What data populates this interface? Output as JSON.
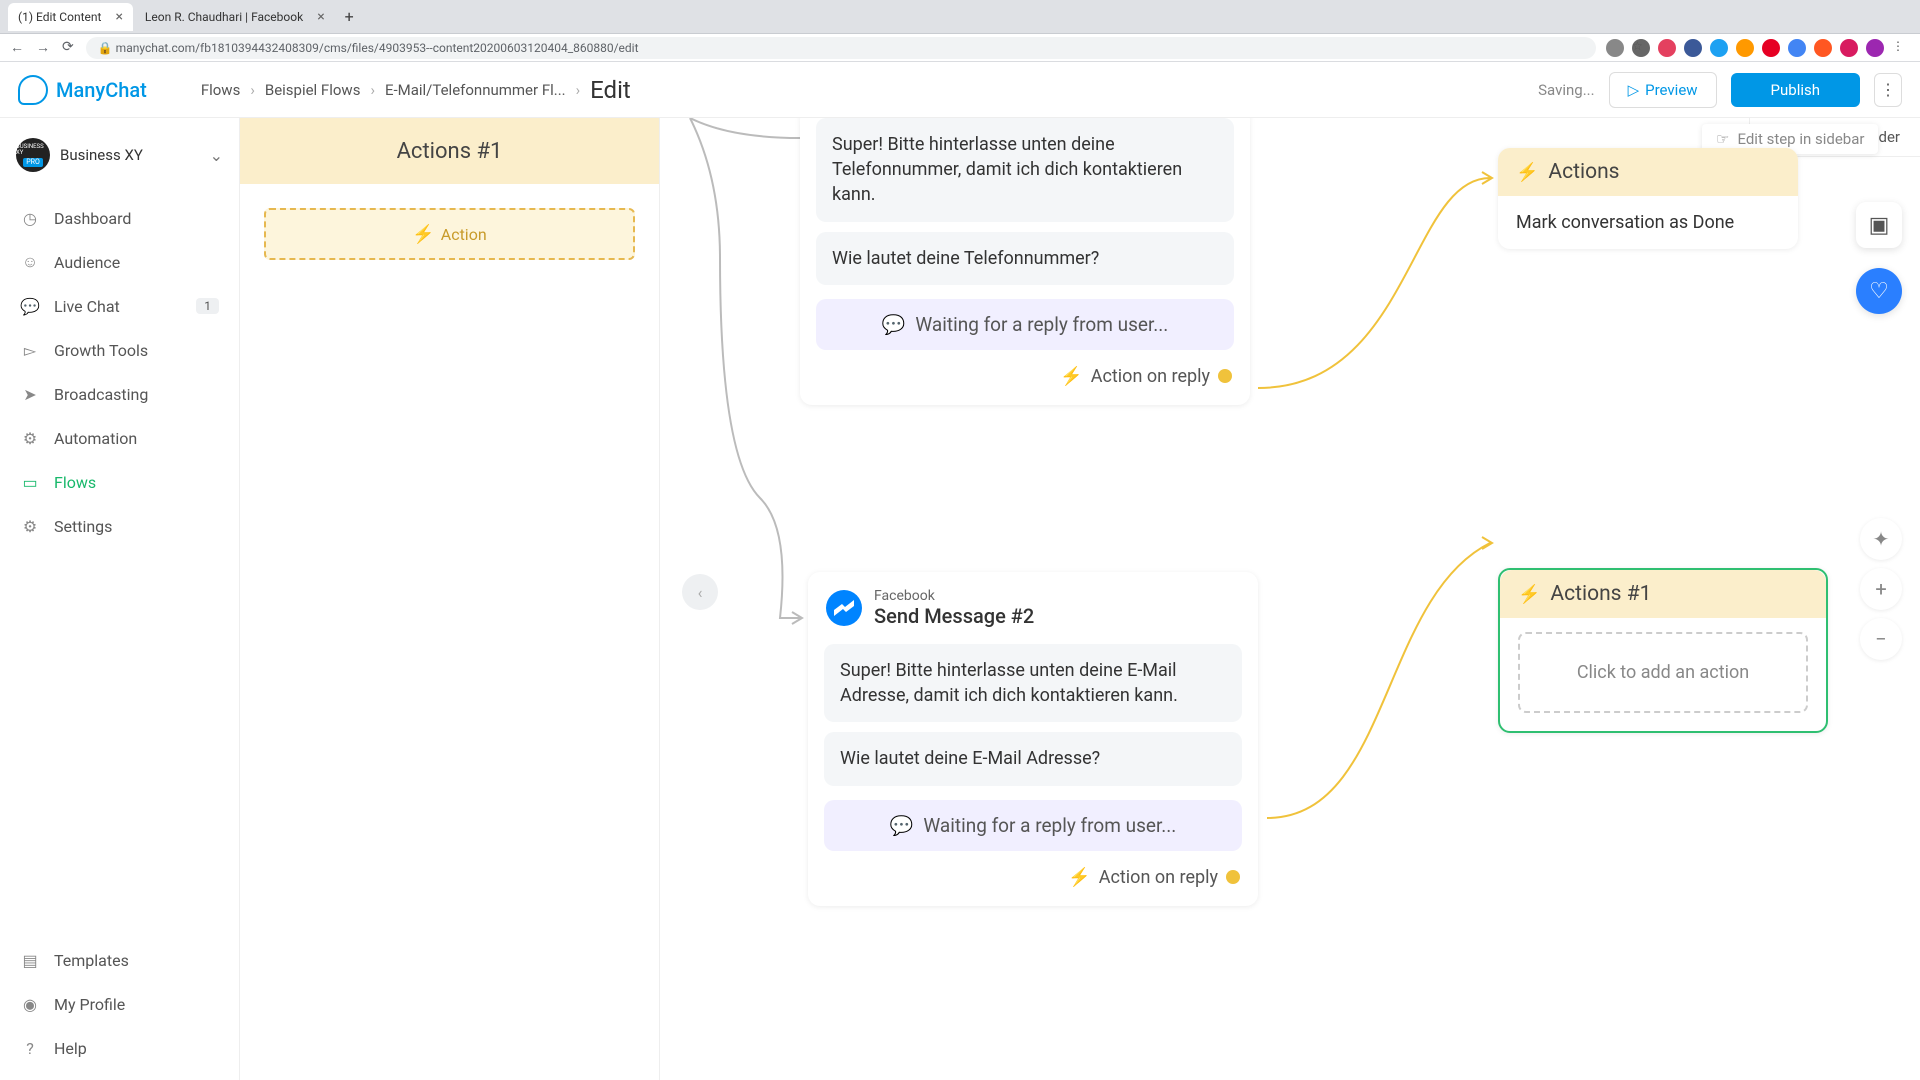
{
  "chrome": {
    "tabs": [
      {
        "title": "(1) Edit Content",
        "active": true
      },
      {
        "title": "Leon R. Chaudhari | Facebook",
        "active": false
      }
    ],
    "url": "manychat.com/fb1810394432408309/cms/files/4903953--content20200603120404_860880/edit"
  },
  "brand": "ManyChat",
  "workspace": {
    "name": "Business XY",
    "tier": "PRO"
  },
  "nav": {
    "dashboard": "Dashboard",
    "audience": "Audience",
    "livechat": "Live Chat",
    "livechat_badge": "1",
    "growth": "Growth Tools",
    "broadcasting": "Broadcasting",
    "automation": "Automation",
    "flows": "Flows",
    "settings": "Settings",
    "templates": "Templates",
    "profile": "My Profile",
    "help": "Help"
  },
  "breadcrumbs": {
    "a": "Flows",
    "b": "Beispiel Flows",
    "c": "E-Mail/Telefonnummer Fl...",
    "edit": "Edit"
  },
  "header": {
    "saving": "Saving...",
    "preview": "Preview",
    "publish": "Publish",
    "goto_basic": "Go To Basic Builder"
  },
  "panel": {
    "title": "Actions #1",
    "add_action": "Action"
  },
  "tooltip": {
    "edit_step": "Edit step in sidebar"
  },
  "msg1": {
    "b1": "Super! Bitte hinterlasse unten deine Telefonnummer, damit ich dich kontaktieren kann.",
    "b2": "Wie lautet deine Telefonnummer?",
    "wait": "Waiting for a reply from user...",
    "act": "Action on reply"
  },
  "msg2": {
    "platform": "Facebook",
    "title": "Send Message #2",
    "b1": "Super! Bitte hinterlasse unten deine E-Mail Adresse, damit ich dich kontaktieren kann.",
    "b2": "Wie lautet deine E-Mail Adresse?",
    "wait": "Waiting for a reply from user...",
    "act": "Action on reply"
  },
  "actions_node": {
    "title": "Actions",
    "body": "Mark conversation as Done"
  },
  "actions1_node": {
    "title": "Actions #1",
    "add": "Click to add an action"
  }
}
